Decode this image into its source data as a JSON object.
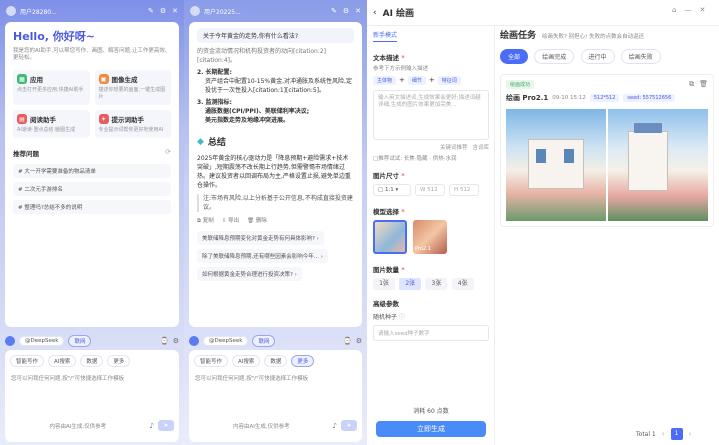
{
  "left": {
    "user": "用户28280...",
    "greeting": "Hello, 你好呀~",
    "intro": "我是您的AI助手,可以帮您写作、画图、解答问题,让工作更高效、更轻松。",
    "cards": [
      {
        "title": "应用",
        "desc": "点击打开更多应用,快捷AI助手",
        "color": "#3fb97a"
      },
      {
        "title": "图像生成",
        "desc": "描述你想要的画面,一键生成图片",
        "color": "#f08a3c"
      },
      {
        "title": "阅读助手",
        "desc": "AI速读·重点总结·脑图生成",
        "color": "#e85d5d"
      },
      {
        "title": "提示词助手",
        "desc": "专业提示词帮你更好地使用AI",
        "color": "#e85d5d"
      }
    ],
    "recommend_title": "推荐问题",
    "questions": [
      "# 大一开学需要准备的物品清单",
      "# 二次元手游排名",
      "# 整理吗?总结不多的说明"
    ],
    "model": "@DeepSeek",
    "net": "联网",
    "tools": [
      "智能写作",
      "AI搜索",
      "数据",
      "更多"
    ],
    "placeholder": "您可以问我任何问题,按\"/\"可快捷选择工作模板",
    "footer": "内容由AI生成,仅供参考"
  },
  "mid": {
    "user": "用户20225...",
    "question": "关于今年黄金的走势,你有什么看法?",
    "para0": "的资金流动情况和机构投资者的动向[citation:2][citation:4]。",
    "h2": "2. 长期配置:",
    "b2": "资产组合中配置10-15%黄金,对冲通胀及系统性风险,定投优于一次性投入[citation:1][citation:5]。",
    "h3": "3. 监测指标:",
    "b3a": "通胀数据(CPI/PPI)、美联储利率决议;",
    "b3b": "美元指数走势及地缘冲突进展。",
    "summary_title": "总结",
    "summary": "2025年黄金的核心驱动力是「降息预期+避险需求+技术突破」,短期震荡不改长期上行趋势,但需警惕市场情绪过热。建议投资者以回调布局为主,严格设置止损,避免单边重仓操作。",
    "note": "注:市场有风险,以上分析基于公开信息,不构成直接投资建议。",
    "actions": [
      "复制",
      "导出",
      "删除"
    ],
    "followups": [
      "美联储降息预期变化对黄金走势有何具体影响?",
      "除了美联储降息预期,还有哪些因素会影响今年...",
      "如何根据黄金走势合理进行投资决策?"
    ],
    "model": "@DeepSeek",
    "net": "联网",
    "tools": [
      "智能写作",
      "AI搜索",
      "数据",
      "更多"
    ],
    "placeholder": "您可以问我任何问题,按\"/\"可快捷选择工作模板",
    "footer": "内容由AI生成,仅供参考"
  },
  "right": {
    "title": "AI 绘画",
    "mode": "新手模式",
    "prompt_label": "文本描述",
    "prompt_hint": "参考下方示例输入描述",
    "prompt_tags": [
      "主体物",
      "细节",
      "特征词"
    ],
    "prompt_placeholder": "输入英文描述词,生成效果会更好;描述词越详细,生成的图片效果更加完美...",
    "keyword_link": "关键词推荐",
    "magic_link": "含词库",
    "style_prefix": "□推荐试试: 长焦·隐藏 · 供热·水润",
    "size_label": "图片尺寸",
    "ratio": "1:1",
    "width": "W 512",
    "height": "H 512",
    "model_label": "模型选择",
    "models": [
      "Pro2.1"
    ],
    "count_label": "图片数量",
    "counts": [
      "1张",
      "2张",
      "3张",
      "4张"
    ],
    "count_selected": 1,
    "adv_label": "高级参数",
    "seed_label": "随机种子",
    "seed_placeholder": "请输入seed种子数字",
    "cost": "消耗 60 点数",
    "generate": "立即生成",
    "task_title": "绘画任务",
    "task_sub": "绘画失败? 别担心! 失败的点数会自动返还",
    "task_tabs": [
      "全部",
      "绘画完成",
      "进行中",
      "绘画失败"
    ],
    "task_selected": 0,
    "status": "绘画成功",
    "task_name": "绘画 Pro2.1",
    "task_time": "09-10 15:12",
    "task_size": "512*512",
    "task_seed": "seed: 557512656",
    "total": "Total 1",
    "page": "1"
  }
}
